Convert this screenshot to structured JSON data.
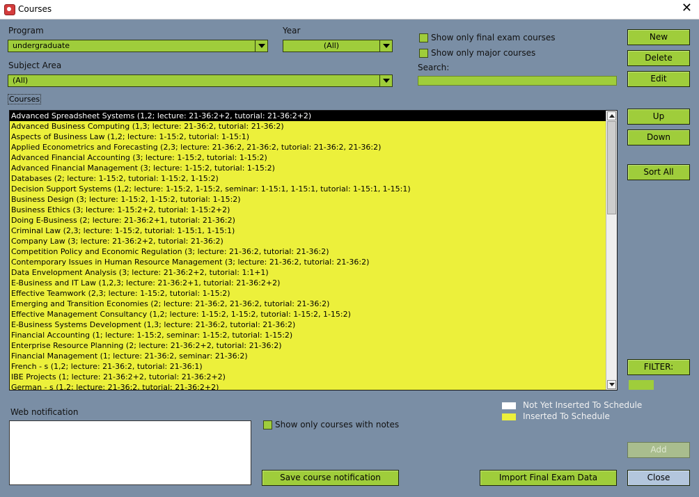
{
  "window": {
    "title": "Courses",
    "close_glyph": "✕",
    "app_icon": "app-logo-icon"
  },
  "program": {
    "label": "Program",
    "value": "undergraduate"
  },
  "year": {
    "label": "Year",
    "value": "(All)"
  },
  "subject_area": {
    "label": "Subject Area",
    "value": "(All)"
  },
  "options": {
    "final_exam": "Show only final exam courses",
    "major": "Show only major courses",
    "with_notes": "Show only courses with notes"
  },
  "search": {
    "label": "Search:",
    "value": ""
  },
  "buttons": {
    "new": "New",
    "delete": "Delete",
    "edit": "Edit",
    "up": "Up",
    "down": "Down",
    "sort_all": "Sort All",
    "filter": "FILTER:",
    "add": "Add",
    "close": "Close",
    "save_notification": "Save course notification",
    "import_final_exam": "Import Final Exam Data"
  },
  "courses": {
    "label": "Courses",
    "items": [
      "Advanced Spreadsheet Systems (1,2; lecture: 21-36:2+2, tutorial: 21-36:2+2)",
      "Advanced Business Computing (1,3; lecture: 21-36:2, tutorial: 21-36:2)",
      "Aspects of Business Law (1,2; lecture: 1-15:2, tutorial: 1-15:1)",
      "Applied Econometrics and  Forecasting (2,3; lecture: 21-36:2, 21-36:2, tutorial: 21-36:2, 21-36:2)",
      "Advanced Financial Accounting (3; lecture: 1-15:2, tutorial: 1-15:2)",
      "Advanced Financial Management (3; lecture: 1-15:2, tutorial: 1-15:2)",
      "Databases (2; lecture: 1-15:2, tutorial: 1-15:2, 1-15:2)",
      "Decision Support Systems (1,2; lecture: 1-15:2, 1-15:2, seminar: 1-15:1, 1-15:1, tutorial: 1-15:1, 1-15:1)",
      "Business Design (3; lecture: 1-15:2, 1-15:2, tutorial: 1-15:2)",
      "Business Ethics (3; lecture: 1-15:2+2, tutorial: 1-15:2+2)",
      "Doing E-Business (2; lecture: 21-36:2+1, tutorial: 21-36:2)",
      "Criminal Law (2,3; lecture: 1-15:2, tutorial: 1-15:1, 1-15:1)",
      "Company Law (3; lecture: 21-36:2+2, tutorial: 21-36:2)",
      "Competition Policy and Economic Regulation (3; lecture: 21-36:2, tutorial: 21-36:2)",
      "Contemporary Issues in Human  Resource Management (3; lecture: 21-36:2, tutorial: 21-36:2)",
      "Data Envelopment Analysis (3; lecture: 21-36:2+2, tutorial: 1:1+1)",
      "E-Business and IT Law (1,2,3; lecture: 21-36:2+1, tutorial: 21-36:2+2)",
      "Effective Teamwork (2,3; lecture: 1-15:2, tutorial: 1-15:2)",
      "Emerging and Transition Economies (2; lecture: 21-36:2, 21-36:2, tutorial: 21-36:2)",
      "Effective Management Consultancy (1,2; lecture: 1-15:2, 1-15:2, tutorial: 1-15:2, 1-15:2)",
      "E-Business Systems Development (1,3; lecture: 21-36:2, tutorial: 21-36:2)",
      "Financial Accounting (1; lecture: 1-15:2, seminar: 1-15:2, tutorial: 1-15:2)",
      "Enterprise Resource Planning (2; lecture: 21-36:2+2, tutorial: 21-36:2)",
      "Financial Management (1; lecture: 21-36:2, seminar: 21-36:2)",
      "French  - s (1,2; lecture: 21-36:2, tutorial: 21-36:1)",
      "IBE Projects (1; lecture: 21-36:2+2, tutorial: 21-36:2+2)",
      "German - s (1,2; lecture: 21-36:2, tutorial: 21-36:2+2)"
    ]
  },
  "web_notification": {
    "label": "Web notification",
    "value": ""
  },
  "legend": {
    "not_inserted": "Not Yet Inserted To Schedule",
    "inserted": "Inserted To Schedule",
    "not_inserted_color": "#ffffff",
    "inserted_color": "#ecf03b"
  },
  "colors": {
    "accent_green": "#9fcd3b",
    "background": "#7a8ea5",
    "list_yellow": "#ecf03b"
  }
}
